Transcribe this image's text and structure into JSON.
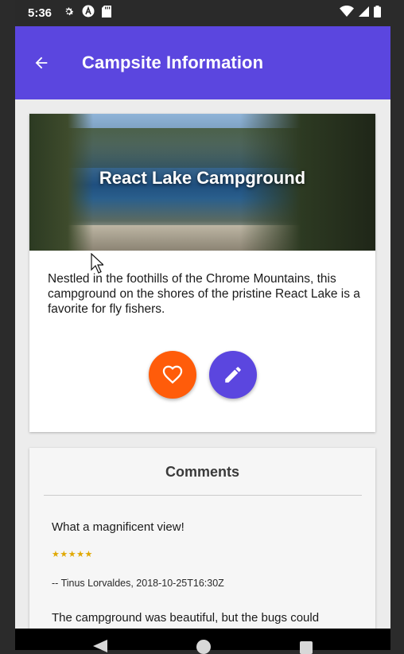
{
  "status_bar": {
    "time": "5:36",
    "icons_left": [
      "gear-icon",
      "a-badge-icon",
      "sd-card-icon"
    ],
    "icons_right": [
      "wifi-icon",
      "signal-icon",
      "battery-icon"
    ]
  },
  "app_bar": {
    "title": "Campsite Information",
    "back_icon": "arrow-left-icon",
    "color": "#5b46df"
  },
  "campsite": {
    "name": "React Lake Campground",
    "description": "Nestled in the foothills of the Chrome Mountains, this campground on the shores of the pristine React Lake is a favorite for fly fishers.",
    "actions": {
      "favorite_icon": "heart-outline-icon",
      "favorite_color": "#ff5c0a",
      "edit_icon": "pencil-icon",
      "edit_color": "#5b46df"
    }
  },
  "comments": {
    "title": "Comments",
    "items": [
      {
        "text": "What a magnificent view!",
        "stars": "★★★★★",
        "rating": 5,
        "author": "-- Tinus Lorvaldes, 2018-10-25T16:30Z"
      },
      {
        "text": "The campground was beautiful, but the bugs could"
      }
    ]
  },
  "navigation": {
    "back_icon": "triangle-back-icon",
    "home_icon": "circle-home-icon",
    "recents_icon": "square-recents-icon"
  }
}
